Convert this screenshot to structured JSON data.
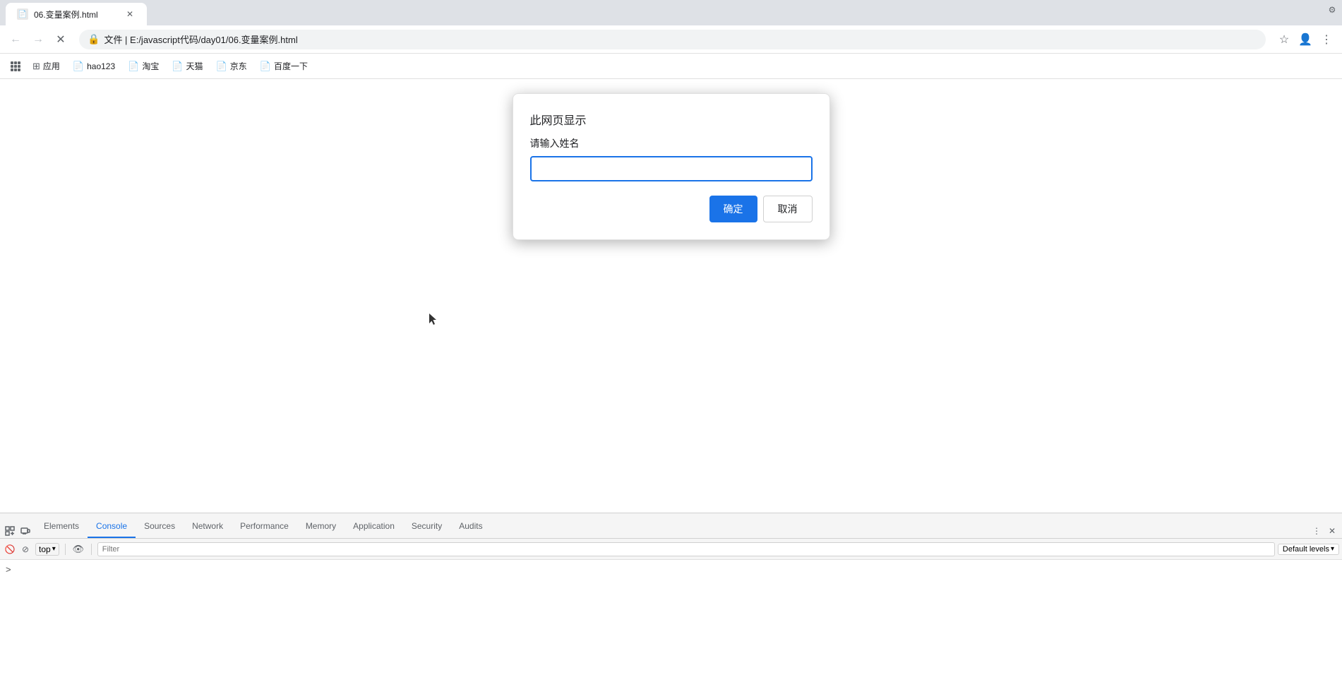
{
  "browser": {
    "tab": {
      "title": "06.变量案例.html",
      "favicon": "📄"
    },
    "toolbar": {
      "back_btn": "←",
      "forward_btn": "→",
      "reload_btn": "✕",
      "address": "文件 | E:/javascript代码/day01/06.变量案例.html",
      "bookmark_btn": "☆",
      "profile_btn": "👤",
      "menu_btn": "⋮"
    },
    "bookmarks": [
      {
        "label": "应用",
        "icon": "⊞"
      },
      {
        "label": "hao123",
        "icon": "📄"
      },
      {
        "label": "淘宝",
        "icon": "📄"
      },
      {
        "label": "天猫",
        "icon": "📄"
      },
      {
        "label": "京东",
        "icon": "📄"
      },
      {
        "label": "百度一下",
        "icon": "📄"
      }
    ]
  },
  "dialog": {
    "title": "此网页显示",
    "label": "请输入姓名",
    "input_value": "",
    "confirm_btn": "确定",
    "cancel_btn": "取消"
  },
  "devtools": {
    "tabs": [
      {
        "label": "Elements",
        "active": false
      },
      {
        "label": "Console",
        "active": true
      },
      {
        "label": "Sources",
        "active": false
      },
      {
        "label": "Network",
        "active": false
      },
      {
        "label": "Performance",
        "active": false
      },
      {
        "label": "Memory",
        "active": false
      },
      {
        "label": "Application",
        "active": false
      },
      {
        "label": "Security",
        "active": false
      },
      {
        "label": "Audits",
        "active": false
      }
    ],
    "toolbar": {
      "frame_label": "top",
      "filter_placeholder": "Filter",
      "default_levels": "Default levels",
      "dropdown_icon": "▾"
    },
    "prompt": ">"
  }
}
